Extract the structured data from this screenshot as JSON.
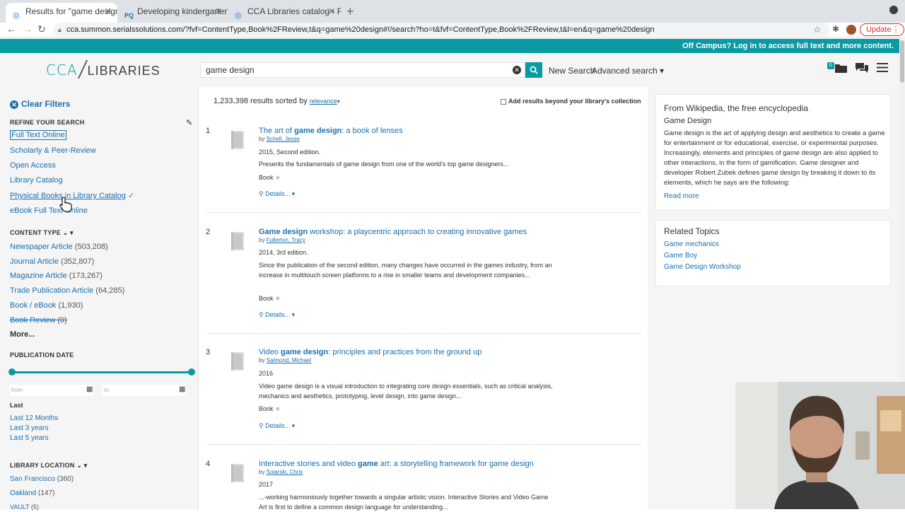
{
  "browser": {
    "tabs": [
      {
        "title": "Results for \"game design\" - CC"
      },
      {
        "title": "Developing kindergarten stude"
      },
      {
        "title": "CCA Libraries catalog › Placing"
      }
    ],
    "url": "cca.summon.serialssolutions.com/?fvf=ContentType,Book%2FReview,t&q=game%20design#!/search?ho=t&fvf=ContentType,Book%2FReview,t&l=en&q=game%20design",
    "update_label": "Update"
  },
  "banner": {
    "text": "Off Campus? Log in to access full text and more content."
  },
  "header": {
    "logo_cca": "CCA",
    "logo_libraries": "LIBRARIES",
    "search_value": "game design",
    "new_search": "New Search",
    "advanced_search": "Advanced search ▾",
    "badge_count": "0"
  },
  "sidebar": {
    "clear_filters": "Clear Filters",
    "refine_heading": "REFINE YOUR SEARCH",
    "refine_items": [
      "Full Text Online",
      "Scholarly & Peer-Review",
      "Open Access",
      "Library Catalog",
      "Physical Books in Library Catalog",
      "eBook Full Text Online"
    ],
    "content_type_heading": "CONTENT TYPE ⌄ ▾",
    "content_types": [
      {
        "label": "Newspaper Article",
        "count": "(503,208)"
      },
      {
        "label": "Journal Article",
        "count": "(352,807)"
      },
      {
        "label": "Magazine Article",
        "count": "(173,267)"
      },
      {
        "label": "Trade Publication Article",
        "count": "(64,285)"
      },
      {
        "label": "Book / eBook",
        "count": "(1,930)"
      },
      {
        "label": "Book Review",
        "count": "(0)"
      }
    ],
    "more": "More...",
    "pubdate_heading": "PUBLICATION DATE",
    "from_placeholder": "from",
    "to_placeholder": "to",
    "last_heading": "Last",
    "last_items": [
      "Last 12 Months",
      "Last 3 years",
      "Last 5 years"
    ],
    "location_heading": "LIBRARY LOCATION ⌄ ▾",
    "locations": [
      {
        "label": "San Francisco",
        "count": "(360)"
      },
      {
        "label": "Oakland",
        "count": "(147)"
      },
      {
        "label": "VAULT",
        "count": "(5)"
      }
    ]
  },
  "results": {
    "count_text": "1,233,398 results sorted by",
    "sort_label": "relevance",
    "beyond_label": "Add results beyond your library's collection",
    "details_label": "Details...",
    "items": [
      {
        "num": "1",
        "title_pre": "The art of ",
        "title_bold": "game design",
        "title_post": ": a book of lenses",
        "author": "Schell, Jesse",
        "meta": "2015, Second edition.",
        "desc": "Presents the fundamentals of game design from one of the world's top game designers...",
        "format": "Book"
      },
      {
        "num": "2",
        "title_pre": "",
        "title_bold": "Game design",
        "title_post": " workshop: a playcentric approach to creating innovative games",
        "author": "Fullerton, Tracy",
        "meta": "2014, 3rd edition.",
        "desc": "Since the publication of the second edition, many changes have occurred in the games industry, from an increase in multitouch screen platforms to a rise in smaller teams and development companies...",
        "format": "Book"
      },
      {
        "num": "3",
        "title_pre": "Video ",
        "title_bold": "game design",
        "title_post": ": principles and practices from the ground up",
        "author": "Salmond, Michael",
        "meta": "2016",
        "desc": "Video game design is a visual introduction to integrating core design essentials, such as critical analysis, mechanics and aesthetics, prototyping, level design, into game design...",
        "format": "Book"
      },
      {
        "num": "4",
        "title_pre": "Interactive stories and video ",
        "title_bold": "game",
        "title_post": " art: a storytelling framework for game design",
        "author": "Solarski, Chris",
        "meta": "2017",
        "desc": "...-working harmoniously together towards a singular artistic vision. Interactive Stories and Video Game Art is first to define a common design language for understanding..."
      }
    ]
  },
  "wikipedia": {
    "heading": "From Wikipedia, the free encyclopedia",
    "title": "Game Design",
    "text": "Game design is the art of applying design and aesthetics to create a game for entertainment or for educational, exercise, or experimental purposes. Increasingly, elements and principles of game design are also applied to other interactions, in the form of gamification. Game designer and developer Robert Zubek defines game design by breaking it down to its elements, which he says are the following:",
    "read_more": "Read more"
  },
  "related": {
    "heading": "Related Topics",
    "items": [
      "Game mechanics",
      "Game Boy",
      "Game Design Workshop"
    ]
  },
  "colors": {
    "accent": "#0a9aa4",
    "link": "#1a6fb0"
  }
}
